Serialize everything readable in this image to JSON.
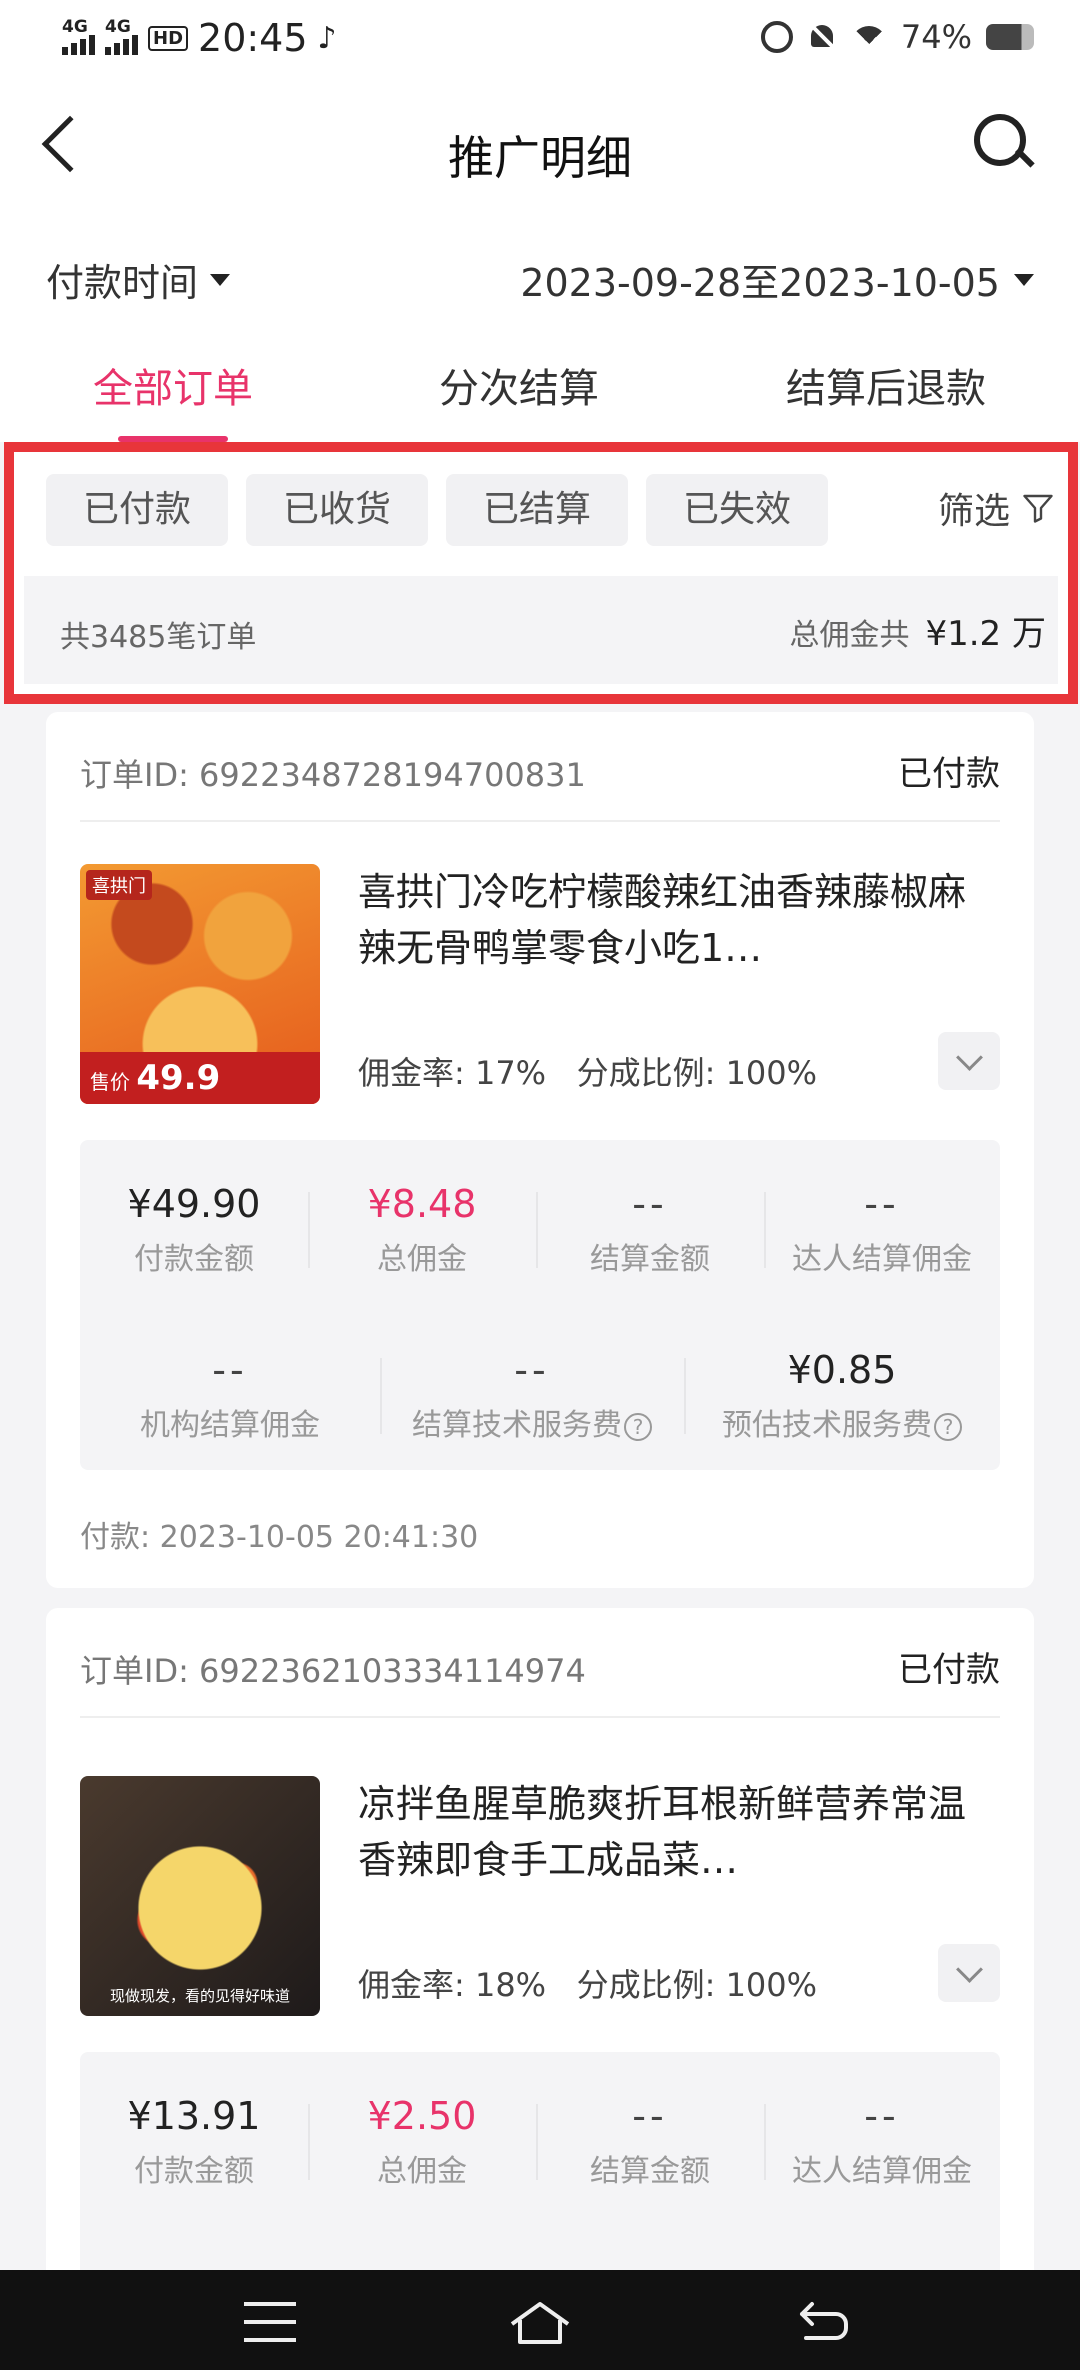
{
  "status_bar": {
    "net1": "4G",
    "net2": "4G",
    "hd": "HD",
    "time": "20:45",
    "battery": "74%"
  },
  "header": {
    "title": "推广明细"
  },
  "filters": {
    "time_type": "付款时间",
    "date_range": "2023-09-28至2023-10-05"
  },
  "tabs": [
    {
      "label": "全部订单",
      "active": true
    },
    {
      "label": "分次结算",
      "active": false
    },
    {
      "label": "结算后退款",
      "active": false
    }
  ],
  "status_filter": {
    "chips": [
      "已付款",
      "已收货",
      "已结算",
      "已失效"
    ],
    "screen_label": "筛选",
    "order_count": "共3485笔订单",
    "total_label": "总佣金共",
    "total_amount": "¥1.2 万"
  },
  "orders": [
    {
      "id_text": "订单ID: 6922348728194700831",
      "status": "已付款",
      "name": "喜拱门冷吃柠檬酸辣红油香辣藤椒麻辣无骨鸭掌零食小吃1…",
      "rate": "佣金率: 17%",
      "split": "分成比例: 100%",
      "image_labels": {
        "brand": "喜拱门",
        "price_label": "售价",
        "price": "49.9"
      },
      "stats_row1": [
        {
          "value": "¥49.90",
          "label": "付款金额",
          "highlight": false
        },
        {
          "value": "¥8.48",
          "label": "总佣金",
          "highlight": true
        },
        {
          "value": "--",
          "label": "结算金额",
          "highlight": false
        },
        {
          "value": "--",
          "label": "达人结算佣金",
          "highlight": false
        }
      ],
      "stats_row2": [
        {
          "value": "--",
          "label": "机构结算佣金"
        },
        {
          "value": "--",
          "label": "结算技术服务费"
        },
        {
          "value": "¥0.85",
          "label": "预估技术服务费"
        }
      ],
      "pay_time": "付款: 2023-10-05 20:41:30"
    },
    {
      "id_text": "订单ID: 6922362103334114974",
      "status": "已付款",
      "name": "凉拌鱼腥草脆爽折耳根新鲜营养常温香辣即食手工成品菜…",
      "rate": "佣金率: 18%",
      "split": "分成比例: 100%",
      "image_labels": {
        "caption": "现做现发，看的见得好味道"
      },
      "stats_row1": [
        {
          "value": "¥13.91",
          "label": "付款金额",
          "highlight": false
        },
        {
          "value": "¥2.50",
          "label": "总佣金",
          "highlight": true
        },
        {
          "value": "--",
          "label": "结算金额",
          "highlight": false
        },
        {
          "value": "--",
          "label": "达人结算佣金",
          "highlight": false
        }
      ]
    }
  ]
}
